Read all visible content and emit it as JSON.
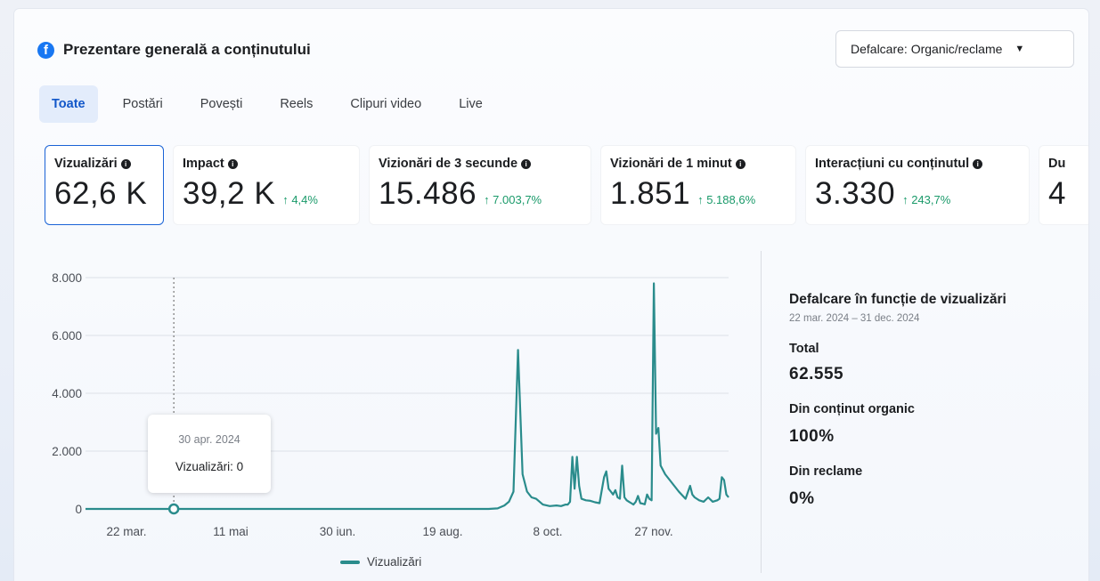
{
  "header": {
    "title": "Prezentare generală a conținutului",
    "breakdown_button": "Defalcare: Organic/reclame"
  },
  "tabs": [
    {
      "label": "Toate",
      "active": true
    },
    {
      "label": "Postări"
    },
    {
      "label": "Povești"
    },
    {
      "label": "Reels"
    },
    {
      "label": "Clipuri video"
    },
    {
      "label": "Live"
    }
  ],
  "metrics": [
    {
      "label": "Vizualizări",
      "value": "62,6 K",
      "change": ""
    },
    {
      "label": "Impact",
      "value": "39,2 K",
      "change": "↑ 4,4%"
    },
    {
      "label": "Vizionări de 3 secunde",
      "value": "15.486",
      "change": "↑ 7.003,7%"
    },
    {
      "label": "Vizionări de 1 minut",
      "value": "1.851",
      "change": "↑ 5.188,6%"
    },
    {
      "label": "Interacțiuni cu conținutul",
      "value": "3.330",
      "change": "↑ 243,7%"
    },
    {
      "label": "Du",
      "value": "4",
      "change": ""
    }
  ],
  "tooltip": {
    "date": "30 apr. 2024",
    "text": "Vizualizări: 0"
  },
  "legend": {
    "label": "Vizualizări"
  },
  "side": {
    "title": "Defalcare în funcție de vizualizări",
    "range": "22 mar. 2024 – 31 dec. 2024",
    "total_label": "Total",
    "total_value": "62.555",
    "organic_label": "Din conținut organic",
    "organic_value": "100%",
    "ads_label": "Din reclame",
    "ads_value": "0%"
  },
  "colors": {
    "line": "#2a8c8c",
    "accent": "#1a63d6",
    "positive": "#1a9a6a"
  },
  "chart_data": {
    "type": "line",
    "yticks": [
      "8.000",
      "6.000",
      "4.000",
      "2.000",
      "0"
    ],
    "xticks": [
      "22 mar.",
      "11 mai",
      "30 iun.",
      "19 aug.",
      "8 oct.",
      "27 nov."
    ],
    "ylim": [
      0,
      8000
    ],
    "xlim": [
      0,
      284
    ],
    "series": [
      {
        "name": "Vizualizări",
        "x": [
          0,
          130,
          178,
          182,
          185,
          187,
          189,
          191,
          193,
          195,
          197,
          199,
          202,
          205,
          208,
          210,
          212,
          213,
          214,
          215,
          216,
          217,
          218,
          219,
          221,
          223,
          225,
          227,
          229,
          230,
          231,
          232,
          233,
          234,
          235,
          236,
          237,
          238,
          239,
          240,
          241,
          242,
          243,
          244,
          245,
          246,
          247,
          248,
          249,
          250,
          251,
          252,
          253,
          254,
          256,
          258,
          260,
          262,
          265,
          267,
          268,
          269,
          271,
          273,
          275,
          277,
          279,
          280,
          281,
          282,
          283,
          284
        ],
        "y": [
          0,
          0,
          0,
          20,
          120,
          250,
          600,
          5500,
          1200,
          600,
          400,
          350,
          150,
          100,
          120,
          100,
          150,
          150,
          250,
          1800,
          700,
          1800,
          800,
          350,
          300,
          280,
          230,
          200,
          1100,
          1300,
          700,
          600,
          500,
          650,
          400,
          350,
          1500,
          400,
          300,
          250,
          200,
          150,
          250,
          450,
          200,
          180,
          160,
          500,
          350,
          300,
          7800,
          2600,
          2800,
          1500,
          1200,
          1000,
          800,
          600,
          350,
          800,
          500,
          400,
          300,
          250,
          400,
          250,
          300,
          350,
          1100,
          1000,
          500,
          400
        ]
      }
    ],
    "annotation": {
      "x": 39,
      "y": 0,
      "date": "30 apr. 2024",
      "value": 0
    }
  }
}
